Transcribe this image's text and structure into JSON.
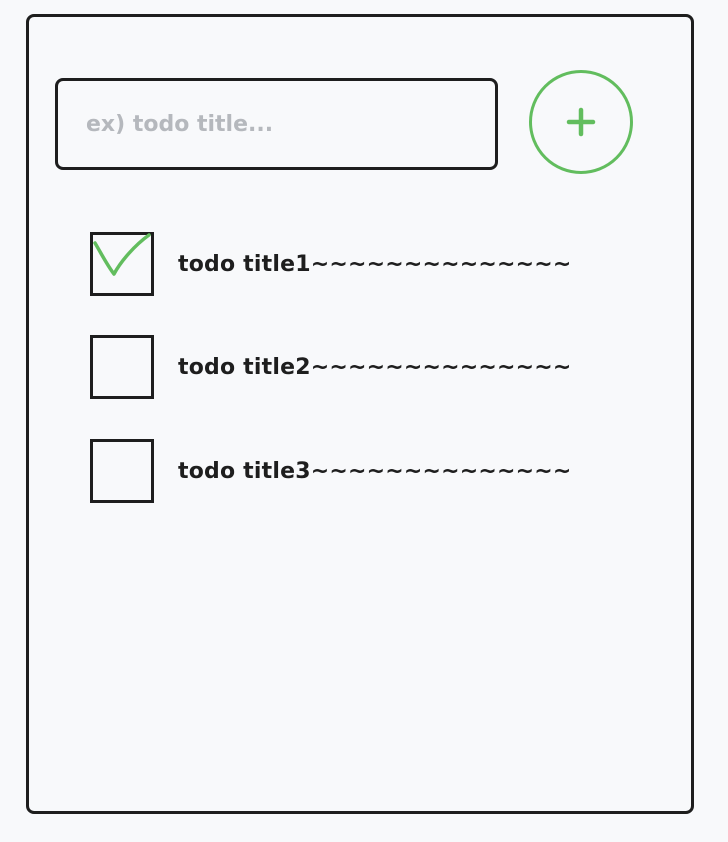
{
  "new_todo": {
    "placeholder": "ex) todo title...",
    "value": ""
  },
  "add_button": {
    "icon": "plus-icon",
    "color": "#62bd5e"
  },
  "todos": [
    {
      "title": "todo title1~~~~~~~~~~~~~~",
      "checked": true
    },
    {
      "title": "todo title2~~~~~~~~~~~~~~",
      "checked": false
    },
    {
      "title": "todo title3~~~~~~~~~~~~~~",
      "checked": false
    }
  ],
  "colors": {
    "outline": "#1e1e1e",
    "accent": "#62bd5e",
    "placeholder": "#b5b8bd",
    "background": "#f8f9fb"
  }
}
